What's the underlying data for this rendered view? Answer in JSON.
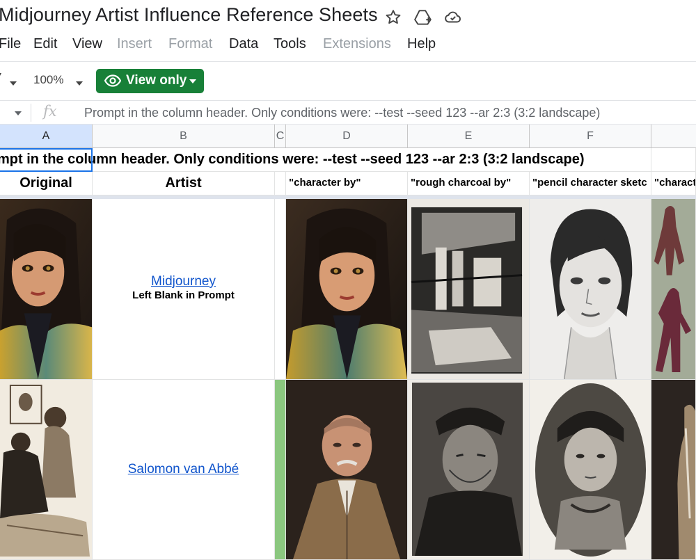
{
  "document": {
    "title": "Midjourney Artist Influence Reference Sheets",
    "icons": [
      "star-icon",
      "move-to-drive-icon",
      "cloud-status-icon"
    ]
  },
  "menu": [
    "File",
    "Edit",
    "View",
    "Insert",
    "Format",
    "Data",
    "Tools",
    "Extensions",
    "Help"
  ],
  "menu_disabled": [
    "Insert",
    "Format",
    "Extensions"
  ],
  "toolbar": {
    "zoom": "100%",
    "view_only_label": "View only",
    "accent_color": "#188038"
  },
  "formula_bar": {
    "fx": "fx",
    "content": "Prompt in the column header. Only conditions were:  --test --seed 123 --ar 2:3 (3:2 landscape)"
  },
  "columns": [
    "A",
    "B",
    "C",
    "D",
    "E",
    "F"
  ],
  "sheet": {
    "banner": "mpt in the column header. Only conditions were:  --test --seed 123 --ar 2:3 (3:2 landscape)",
    "headers": {
      "original": "Original",
      "artist": "Artist",
      "d": "\"character by\"",
      "e": "\"rough charcoal by\"",
      "f": "\"pencil character sketc",
      "g": "\"charact"
    },
    "rows": [
      {
        "artist_link": "Midjourney",
        "artist_note": "Left Blank in Prompt"
      },
      {
        "artist_link": "Salomon van Abbé",
        "artist_note": ""
      }
    ]
  }
}
